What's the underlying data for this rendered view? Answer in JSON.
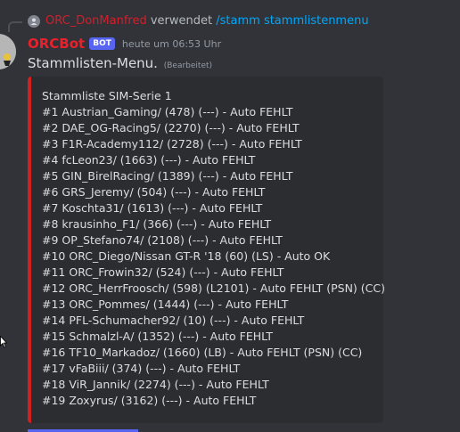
{
  "reply": {
    "username": "ORC_DonManfred",
    "verb": "verwendet",
    "command": "/stamm stammlistenmenu"
  },
  "message": {
    "author": "ORCBot",
    "bot_tag": "BOT",
    "timestamp": "heute um 06:53 Uhr",
    "text": "Stammlisten-Menu.",
    "edited_label": "(Bearbeitet)"
  },
  "embed": {
    "accent_color": "#d21f1f",
    "lines": [
      "Stammliste SIM-Serie 1",
      "#1 Austrian_Gaming/ (478) (---) - Auto FEHLT",
      "#2 DAE_OG-Racing5/ (2270) (---) - Auto FEHLT",
      "#3 F1R-Academy112/ (2728) (---) - Auto FEHLT",
      "#4 fcLeon23/ (1663) (---) - Auto FEHLT",
      "#5 GIN_BirelRacing/ (1389) (---) - Auto FEHLT",
      "#6 GRS_Jeremy/ (504) (---) - Auto FEHLT",
      "#7 Koschta31/ (1613) (---) - Auto FEHLT",
      "#8 krausinho_F1/ (366) (---) - Auto FEHLT",
      "#9 OP_Stefano74/ (2108) (---) - Auto FEHLT",
      "#10 ORC_Diego/Nissan GT-R '18 (60) (LS) - Auto OK",
      "#11 ORC_Frowin32/ (524) (---) - Auto FEHLT",
      "#12 ORC_HerrFroosch/ (598) (L2101) - Auto FEHLT (PSN) (CC)",
      "#13 ORC_Pommes/ (1444) (---) - Auto FEHLT",
      "#14 PFL-Schumacher92/ (10) (---) - Auto FEHLT",
      "#15 Schmalzl-A/ (1352) (---) - Auto FEHLT",
      "#16 TF10_Markadoz/ (1660) (LB) - Auto FEHLT (PSN) (CC)",
      "#17 vFaBiii/ (374) (---) - Auto FEHLT",
      "#18 ViR_Jannik/ (2274) (---) - Auto FEHLT",
      "#19 Zoxyrus/ (3162) (---) - Auto FEHLT"
    ]
  },
  "colors": {
    "background": "#313338",
    "embed_background": "#2b2d31",
    "bot_name": "#e8222c",
    "bot_tag_bg": "#5865f2",
    "command_link": "#00a8fc"
  }
}
